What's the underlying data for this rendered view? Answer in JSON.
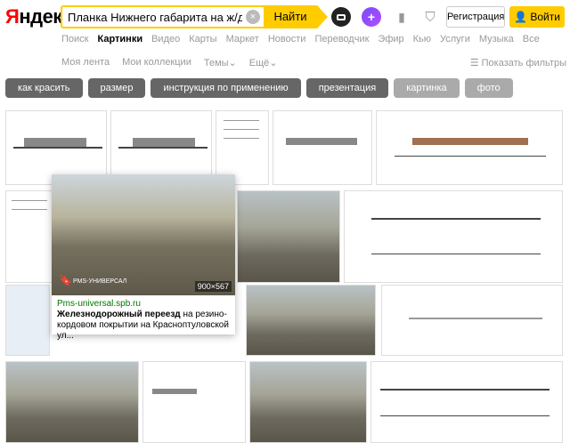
{
  "header": {
    "logo_ya": "Я",
    "logo_rest": "ндекс",
    "search_value": "Планка Нижнего габарита на ж/д пер",
    "clear_glyph": "×",
    "find_label": "Найти",
    "alice_glyph": "+",
    "register_label": "Регистрация",
    "login_label": "Войти"
  },
  "nav": {
    "items": [
      "Поиск",
      "Картинки",
      "Видео",
      "Карты",
      "Маркет",
      "Новости",
      "Переводчик",
      "Эфир",
      "Кью",
      "Услуги",
      "Музыка",
      "Все"
    ]
  },
  "sub": {
    "items": [
      "Моя лента",
      "Мои коллекции",
      "Темы",
      "Ещё"
    ],
    "filters": "Показать фильтры"
  },
  "chips": [
    "как красить",
    "размер",
    "инструкция по применению",
    "презентация",
    "картинка",
    "фото"
  ],
  "popup": {
    "domain": "Pms-universal.spb.ru",
    "title_bold": "Железнодорожный переезд",
    "title_rest": " на резино-кордовом покрытии на Красноптуловской ул...",
    "size": "900×567",
    "watermark": "PMS-УНИВЕРСАЛ"
  },
  "accent": "#ffcc00",
  "icons": [
    "camera-icon",
    "alice-icon",
    "collections-icon",
    "shield-icon",
    "user-icon",
    "chevron-down-icon",
    "filter-icon",
    "bookmark-icon"
  ]
}
